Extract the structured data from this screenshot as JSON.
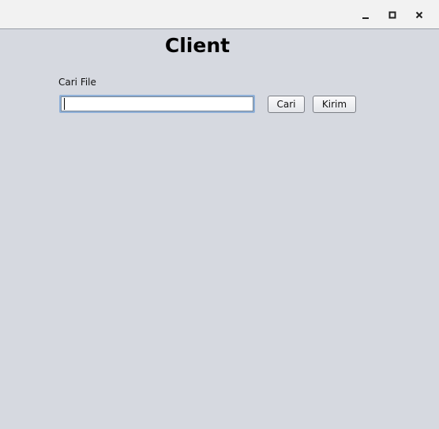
{
  "window": {
    "controls": {
      "minimize_icon": "minimize-icon",
      "maximize_icon": "maximize-icon",
      "close_icon": "close-icon"
    }
  },
  "main": {
    "title": "Client",
    "file_label": "Cari File",
    "file_input": {
      "value": "",
      "placeholder": ""
    },
    "browse_button": "Cari",
    "send_button": "Kirim"
  },
  "colors": {
    "background": "#d6d9e0",
    "titlebar": "#f2f2f2",
    "input_focus_border": "#8fb0d8"
  }
}
